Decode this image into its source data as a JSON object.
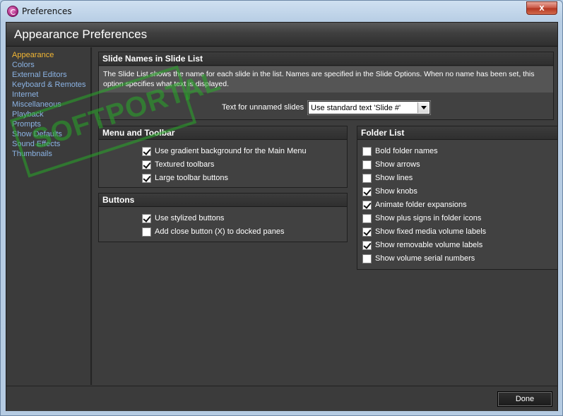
{
  "window": {
    "title": "Preferences",
    "close_label": "x"
  },
  "header": {
    "title": "Appearance Preferences"
  },
  "sidebar": {
    "items": [
      {
        "label": "Appearance",
        "active": true
      },
      {
        "label": "Colors"
      },
      {
        "label": "External Editors"
      },
      {
        "label": "Keyboard & Remotes"
      },
      {
        "label": "Internet"
      },
      {
        "label": "Miscellaneous"
      },
      {
        "label": "Playback"
      },
      {
        "label": "Prompts"
      },
      {
        "label": "Show Defaults"
      },
      {
        "label": "Sound Effects"
      },
      {
        "label": "Thumbnails"
      }
    ]
  },
  "slide_names": {
    "title": "Slide Names in Slide List",
    "description": "The Slide List shows the name for each slide in the list. Names are specified in the Slide Options. When no name has been set, this option specifies what text is displayed.",
    "field_label": "Text for unnamed slides",
    "select_value": "Use standard text 'Slide #'"
  },
  "menu_toolbar": {
    "title": "Menu and Toolbar",
    "options": [
      {
        "label": "Use gradient background for the Main Menu",
        "checked": true
      },
      {
        "label": "Textured toolbars",
        "checked": true
      },
      {
        "label": "Large toolbar buttons",
        "checked": true
      }
    ]
  },
  "buttons": {
    "title": "Buttons",
    "options": [
      {
        "label": "Use stylized buttons",
        "checked": true
      },
      {
        "label": "Add close button (X) to docked panes",
        "checked": false
      }
    ]
  },
  "folder_list": {
    "title": "Folder List",
    "options": [
      {
        "label": "Bold folder names",
        "checked": false
      },
      {
        "label": "Show arrows",
        "checked": false
      },
      {
        "label": "Show lines",
        "checked": false
      },
      {
        "label": "Show knobs",
        "checked": true
      },
      {
        "label": "Animate folder expansions",
        "checked": true
      },
      {
        "label": "Show plus signs in folder icons",
        "checked": false
      },
      {
        "label": "Show fixed media volume labels",
        "checked": true
      },
      {
        "label": "Show removable volume labels",
        "checked": true
      },
      {
        "label": "Show volume serial numbers",
        "checked": false
      }
    ]
  },
  "footer": {
    "done_label": "Done"
  },
  "watermark": {
    "text": "SOFTPORTAL"
  }
}
